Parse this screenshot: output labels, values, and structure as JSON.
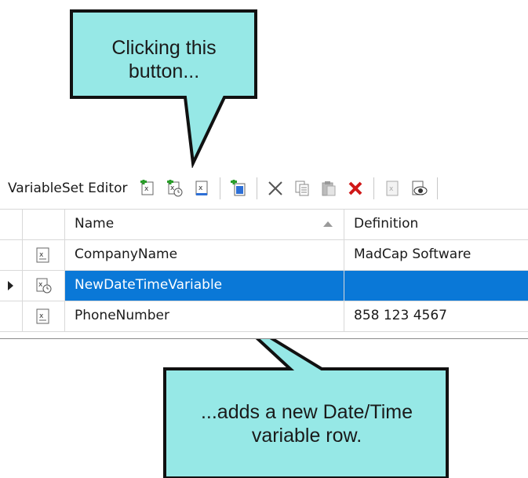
{
  "callouts": {
    "top": "Clicking this button...",
    "bottom": "...adds a new Date/Time variable row."
  },
  "toolbar": {
    "title": "VariableSet Editor",
    "icons": [
      "add-variable-icon",
      "add-datetime-variable-icon",
      "edit-variable-icon",
      "import-icon",
      "cut-icon",
      "copy-icon",
      "paste-icon",
      "delete-icon",
      "reset-icon",
      "preview-icon"
    ]
  },
  "grid": {
    "columns": [
      "Name",
      "Definition"
    ],
    "sort": "ascending",
    "rows": [
      {
        "name": "CompanyName",
        "definition": "MadCap Software",
        "icon": "variable-icon",
        "selected": false
      },
      {
        "name": "NewDateTimeVariable",
        "definition": "",
        "icon": "datetime-variable-icon",
        "selected": true
      },
      {
        "name": "PhoneNumber",
        "definition": "858 123 4567",
        "icon": "variable-icon",
        "selected": false
      }
    ]
  },
  "colors": {
    "callout_fill": "#96e8e6",
    "selection": "#0a78d7"
  }
}
